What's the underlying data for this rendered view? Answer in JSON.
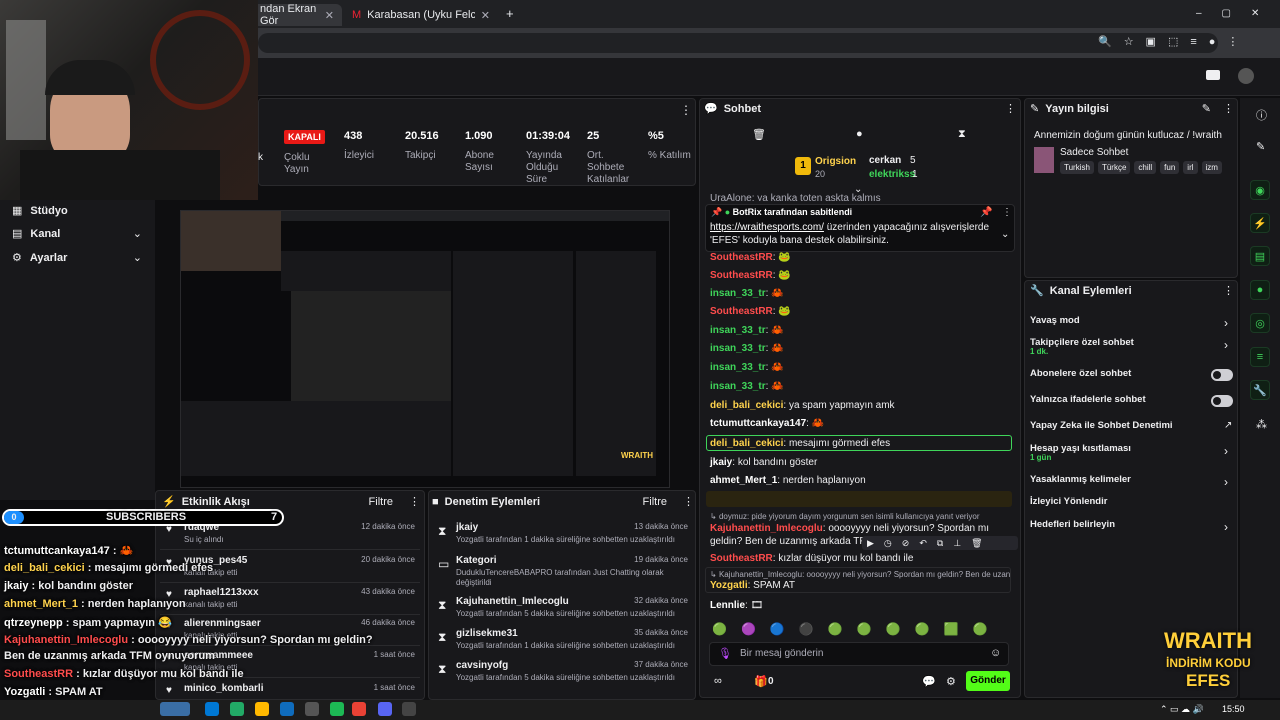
{
  "browser": {
    "tabs": [
      {
        "title": "ndan Ekran Gör"
      },
      {
        "title": "Karabasan (Uyku Felci) Nedir?"
      }
    ],
    "new_tab": "+"
  },
  "left_nav": {
    "items": [
      {
        "label": "Stüdyo"
      },
      {
        "label": "Kanal"
      },
      {
        "label": "Ayarlar"
      }
    ]
  },
  "stats": [
    {
      "value": "KAPALI",
      "label": "Çoklu Yayın"
    },
    {
      "value": "438",
      "label": "İzleyici"
    },
    {
      "value": "20.516",
      "label": "Takipçi"
    },
    {
      "value": "1.090",
      "label": "Abone Sayısı"
    },
    {
      "value": "01:39:04",
      "label": "Yayında Olduğu Süre"
    },
    {
      "value": "25",
      "label": "Ort. Sohbete Katılanlar"
    },
    {
      "value": "%5",
      "label": "% Katılım"
    }
  ],
  "chat": {
    "title": "Sohbet",
    "leaderboard": {
      "first": "Origsion",
      "first_score": "20",
      "second": "cerkan",
      "second_score": "5",
      "third": "elektrikss",
      "third_score": "1"
    },
    "cut_line": "UraAlone: ya kanka toten aşkta kalmış",
    "pinned": {
      "by": "BotRix tarafından sabitlendi",
      "link": "https://wraithesports.com/",
      "text1": " üzerinden yapacağınız alışverişlerde",
      "text2": "'EFES' koduyla bana destek olabilirsiniz."
    },
    "messages": [
      {
        "user": "SoutheastRR",
        "text": "🐸",
        "cls": "u-red"
      },
      {
        "user": "SoutheastRR",
        "text": "🐸",
        "cls": "u-red"
      },
      {
        "user": "insan_33_tr",
        "text": "🦀",
        "cls": "u-green"
      },
      {
        "user": "SoutheastRR",
        "text": "🐸",
        "cls": "u-red"
      },
      {
        "user": "insan_33_tr",
        "text": "🦀",
        "cls": "u-green"
      },
      {
        "user": "insan_33_tr",
        "text": "🦀",
        "cls": "u-green"
      },
      {
        "user": "insan_33_tr",
        "text": "🦀",
        "cls": "u-green"
      },
      {
        "user": "insan_33_tr",
        "text": "🦀",
        "cls": "u-green"
      },
      {
        "user": "deli_bali_cekici",
        "text": "ya spam yapmayın amk",
        "cls": "u-yellow"
      },
      {
        "user": "tctumuttcankaya147",
        "text": "🦀",
        "cls": "u-white"
      },
      {
        "user": "deli_bali_cekici",
        "text": "mesajımı görmedi efes",
        "cls": "u-yellow"
      },
      {
        "user": "jkaiy",
        "text": "kol bandını göster",
        "cls": "u-white"
      },
      {
        "user": "ahmet_Mert_1",
        "text": "nerden haplanıyon",
        "cls": "u-white"
      },
      {
        "user": "qtrzeynepp",
        "text": "spam yapmayın 😂",
        "cls": "u-yellow"
      }
    ],
    "deleted": "doymuz: pide yiyorum dayım yorgunum sen isimli kullanıcıya yanıt veriyor",
    "long_user": "Kajuhanettin_Imlecoglu",
    "long_text": "ooooyyyy neli yiyorsun? Spordan mı geldin? Ben de uzanmış arkada TFM oynuyorum",
    "kizlar_user": "SoutheastRR",
    "kizlar_text": "kızlar düşüyor mu kol bandı ile",
    "reply_ref": "Kajuhanettin_Imlecoglu: ooooyyyy neli yiyorsun? Spordan mı geldin? Ben de uzan...",
    "reply_user": "Yozgatli",
    "reply_text": "SPAM AT",
    "last_user": "Lennlie",
    "input_placeholder": "Bir mesaj gönderin",
    "count": "0",
    "send": "Gönder"
  },
  "stream_info": {
    "title": "Yayın bilgisi",
    "stream_title": "Annemizin doğum günün kutlucaz / !wraith",
    "category": "Sadece Sohbet",
    "tags": [
      "Turkish",
      "Türkçe",
      "chill",
      "fun",
      "irl",
      "izm"
    ]
  },
  "channel_actions": {
    "title": "Kanal Eylemleri",
    "items": [
      {
        "label": "Yavaş mod",
        "sub": "",
        "ctrl": "chevron"
      },
      {
        "label": "Takipçilere özel sohbet",
        "sub": "1 dk.",
        "ctrl": "chevron"
      },
      {
        "label": "Abonelere özel sohbet",
        "sub": "",
        "ctrl": "toggle"
      },
      {
        "label": "Yalnızca ifadelerle sohbet",
        "sub": "",
        "ctrl": "toggle"
      },
      {
        "label": "Yapay Zeka ile Sohbet Denetimi",
        "sub": "",
        "ctrl": "ext"
      },
      {
        "label": "Hesap yaşı kısıtlaması",
        "sub": "1 gün",
        "ctrl": "chevron"
      },
      {
        "label": "Yasaklanmış kelimeler",
        "sub": "",
        "ctrl": "chevron"
      },
      {
        "label": "İzleyici Yönlendir",
        "sub": "",
        "ctrl": ""
      },
      {
        "label": "Hedefleri belirleyin",
        "sub": "",
        "ctrl": "chevron"
      }
    ]
  },
  "activity": {
    "title": "Etkinlik Akışı",
    "filter": "Filtre",
    "items": [
      {
        "user": "rdaqwe",
        "sub": "Su iç alındı",
        "time": "12 dakika önce"
      },
      {
        "user": "yunus_pes45",
        "sub": "kanalı takip etti",
        "time": "20 dakika önce"
      },
      {
        "user": "raphael1213xxx",
        "sub": "kanalı takip etti",
        "time": "43 dakika önce"
      },
      {
        "user": "alierenmingsaer",
        "sub": "kanalı takip etti",
        "time": "46 dakika önce"
      },
      {
        "user": "serrrnammeee",
        "sub": "kanalı takip etti",
        "time": "1 saat önce"
      },
      {
        "user": "minico_kombarli",
        "sub": "",
        "time": "1 saat önce"
      }
    ]
  },
  "moderation": {
    "title": "Denetim Eylemleri",
    "filter": "Filtre",
    "items": [
      {
        "user": "jkaiy",
        "sub": "Yozgatli tarafından 1 dakika süreliğine sohbetten uzaklaştırıldı",
        "time": "13 dakika önce"
      },
      {
        "user": "Kategori",
        "sub": "DudukluTencereBABAPRO tarafından Just Chatting olarak değiştirildi",
        "time": "19 dakika önce"
      },
      {
        "user": "Kajuhanettin_Imlecoglu",
        "sub": "Yozgatli tarafından 5 dakika süreliğine sohbetten uzaklaştırıldı",
        "time": "32 dakika önce"
      },
      {
        "user": "gizlisekme31",
        "sub": "Yozgatli tarafından 1 dakika süreliğine sohbetten uzaklaştırıldı",
        "time": "35 dakika önce"
      },
      {
        "user": "cavsinyofg",
        "sub": "Yozgatli tarafından 5 dakika süreliğine sohbetten uzaklaştırıldı",
        "time": "37 dakika önce"
      }
    ]
  },
  "overlay": {
    "subscribers_label": "SUBSCRIBERS",
    "subs_left": "0",
    "subs_right": "7",
    "lines": [
      {
        "user": "tctumuttcankaya147",
        "text": "🦀"
      },
      {
        "user": "deli_bali_cekici",
        "text": "mesajımı görmedi efes"
      },
      {
        "user": "jkaiy",
        "text": "kol bandını göster"
      },
      {
        "user": "ahmet_Mert_1",
        "text": "nerden haplanıyon"
      },
      {
        "user": "qtrzeynepp",
        "text": "spam yapmayın 😂"
      },
      {
        "user": "Kajuhanettin_Imlecoglu",
        "text": "ooooyyyy neli yiyorsun? Spordan mı geldin?"
      },
      {
        "user": "",
        "text": "Ben de uzanmış arkada TFM oynuyorum"
      },
      {
        "user": "SoutheastRR",
        "text": "kızlar düşüyor mu kol bandı ile"
      },
      {
        "user": "Yozgatli",
        "text": "SPAM AT"
      }
    ],
    "brand1": "WRAITH",
    "brand2": "İNDİRİM KODU",
    "brand3": "EFES"
  },
  "taskbar": {
    "time": "15:50"
  },
  "colors": {
    "accent": "#53fc18",
    "chat_red": "#ff4d4d",
    "bg": "#0e0e10",
    "panel": "#18181b"
  }
}
